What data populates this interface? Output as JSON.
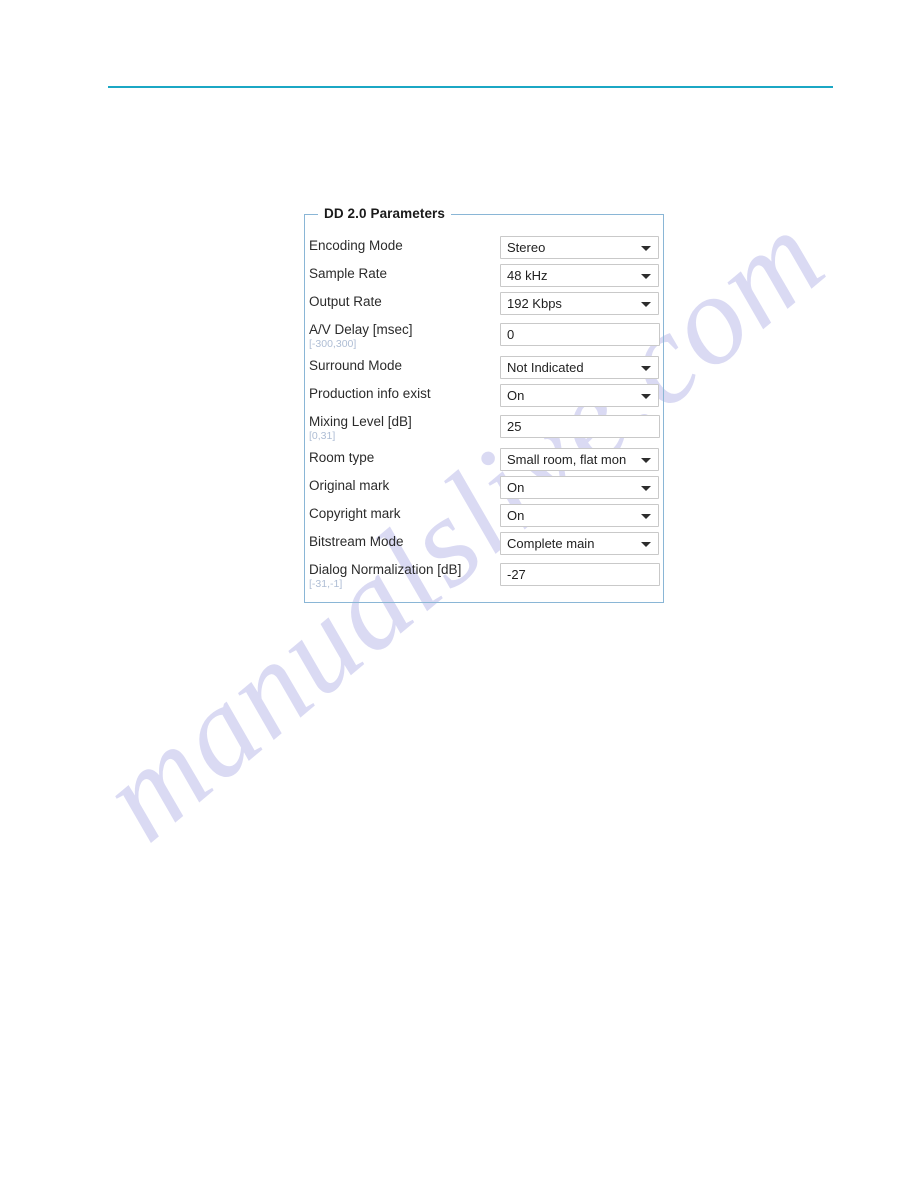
{
  "page": {
    "background_color": "#ffffff",
    "accent_rule_color": "#1ba7c4",
    "watermark": "manualslive.com",
    "watermark_color": "#cdcdef"
  },
  "panel": {
    "legend": "DD 2.0 Parameters",
    "border_color": "#8ab6d6",
    "rows": [
      {
        "label": "Encoding Mode",
        "hint": "",
        "control": "select",
        "value": "Stereo",
        "name": "encoding-mode"
      },
      {
        "label": "Sample Rate",
        "hint": "",
        "control": "select",
        "value": "48 kHz",
        "name": "sample-rate"
      },
      {
        "label": "Output Rate",
        "hint": "",
        "control": "select",
        "value": "192 Kbps",
        "name": "output-rate"
      },
      {
        "label": "A/V Delay [msec]",
        "hint": "[-300,300]",
        "control": "text",
        "value": "0",
        "name": "av-delay"
      },
      {
        "label": "Surround Mode",
        "hint": "",
        "control": "select",
        "value": "Not Indicated",
        "name": "surround-mode"
      },
      {
        "label": "Production info exist",
        "hint": "",
        "control": "select",
        "value": "On",
        "name": "production-info-exist"
      },
      {
        "label": "Mixing Level [dB]",
        "hint": "[0,31]",
        "control": "text",
        "value": "25",
        "name": "mixing-level"
      },
      {
        "label": "Room type",
        "hint": "",
        "control": "select",
        "value": "Small room, flat mon",
        "name": "room-type"
      },
      {
        "label": "Original mark",
        "hint": "",
        "control": "select",
        "value": "On",
        "name": "original-mark"
      },
      {
        "label": "Copyright mark",
        "hint": "",
        "control": "select",
        "value": "On",
        "name": "copyright-mark"
      },
      {
        "label": "Bitstream Mode",
        "hint": "",
        "control": "select",
        "value": "Complete main",
        "name": "bitstream-mode"
      },
      {
        "label": "Dialog Normalization [dB]",
        "hint": "[-31,-1]",
        "control": "text",
        "value": "-27",
        "name": "dialog-normalization"
      }
    ]
  }
}
